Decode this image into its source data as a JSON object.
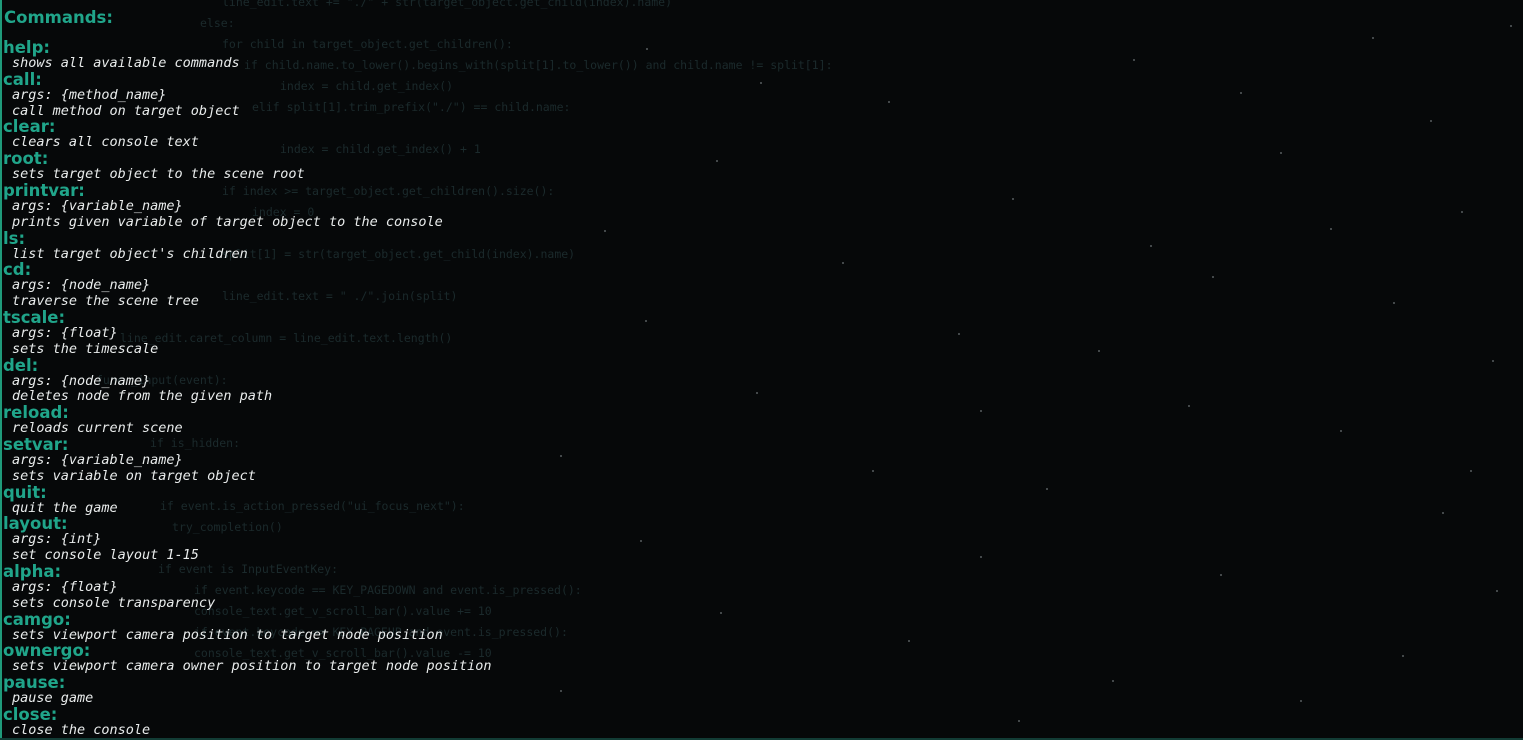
{
  "console": {
    "title": "Commands:",
    "commands": [
      {
        "name": "help:",
        "lines": [
          "shows all available commands"
        ]
      },
      {
        "name": "call:",
        "lines": [
          "args: {method_name}",
          "call method on target object"
        ]
      },
      {
        "name": "clear:",
        "lines": [
          "clears all console text"
        ]
      },
      {
        "name": "root:",
        "lines": [
          "sets target object to the scene root"
        ]
      },
      {
        "name": "printvar:",
        "lines": [
          "args: {variable_name}",
          "prints given variable of target object to the console"
        ]
      },
      {
        "name": "ls:",
        "lines": [
          "list target object's children"
        ]
      },
      {
        "name": "cd:",
        "lines": [
          "args: {node_name}",
          "traverse the scene tree"
        ]
      },
      {
        "name": "tscale:",
        "lines": [
          "args: {float}",
          "sets the timescale"
        ]
      },
      {
        "name": "del:",
        "lines": [
          "args: {node_name}",
          "deletes node from the given path"
        ]
      },
      {
        "name": "reload:",
        "lines": [
          "reloads current scene"
        ]
      },
      {
        "name": "setvar:",
        "lines": [
          "args: {variable_name}",
          "sets variable on target object"
        ]
      },
      {
        "name": "quit:",
        "lines": [
          "quit the game"
        ]
      },
      {
        "name": "layout:",
        "lines": [
          "args: {int}",
          "set console layout 1-15"
        ]
      },
      {
        "name": "alpha:",
        "lines": [
          "args: {float}",
          "sets console transparency"
        ]
      },
      {
        "name": "camgo:",
        "lines": [
          "sets viewport camera position to target node position"
        ]
      },
      {
        "name": "ownergo:",
        "lines": [
          "sets viewport camera owner position to target node position"
        ]
      },
      {
        "name": "pause:",
        "lines": [
          "pause game"
        ]
      },
      {
        "name": "close:",
        "lines": [
          "close the console"
        ]
      }
    ]
  },
  "background_code": [
    "line_edit.text += \"./\" + str(target_object.get_child(index).name)",
    "else:",
    "for child in target_object.get_children():",
    "if child.name.to_lower().begins_with(split[1].to_lower()) and child.name != split[1]:",
    "index = child.get_index()",
    "elif split[1].trim_prefix(\"./\") == child.name:",
    "index = child.get_index() + 1",
    "if index >= target_object.get_children().size():",
    "index = 0",
    "split[1] = str(target_object.get_child(index).name)",
    "line_edit.text = \" ./\".join(split)",
    "line_edit.caret_column = line_edit.text.length()",
    "func _input(event):",
    "if is_hidden:",
    "if event.is_action_pressed(\"ui_focus_next\"):",
    "try_completion()",
    "if event is InputEventKey:",
    "if event.keycode == KEY_PAGEDOWN and event.is_pressed():",
    "console_text.get_v_scroll_bar().value += 10",
    "if event.keycode == KEY_PAGEUP and event.is_pressed():",
    "console_text.get_v_scroll_bar().value -= 10"
  ],
  "colors": {
    "background": "#060809",
    "accent": "#20a58a",
    "text": "#e9ecec"
  }
}
